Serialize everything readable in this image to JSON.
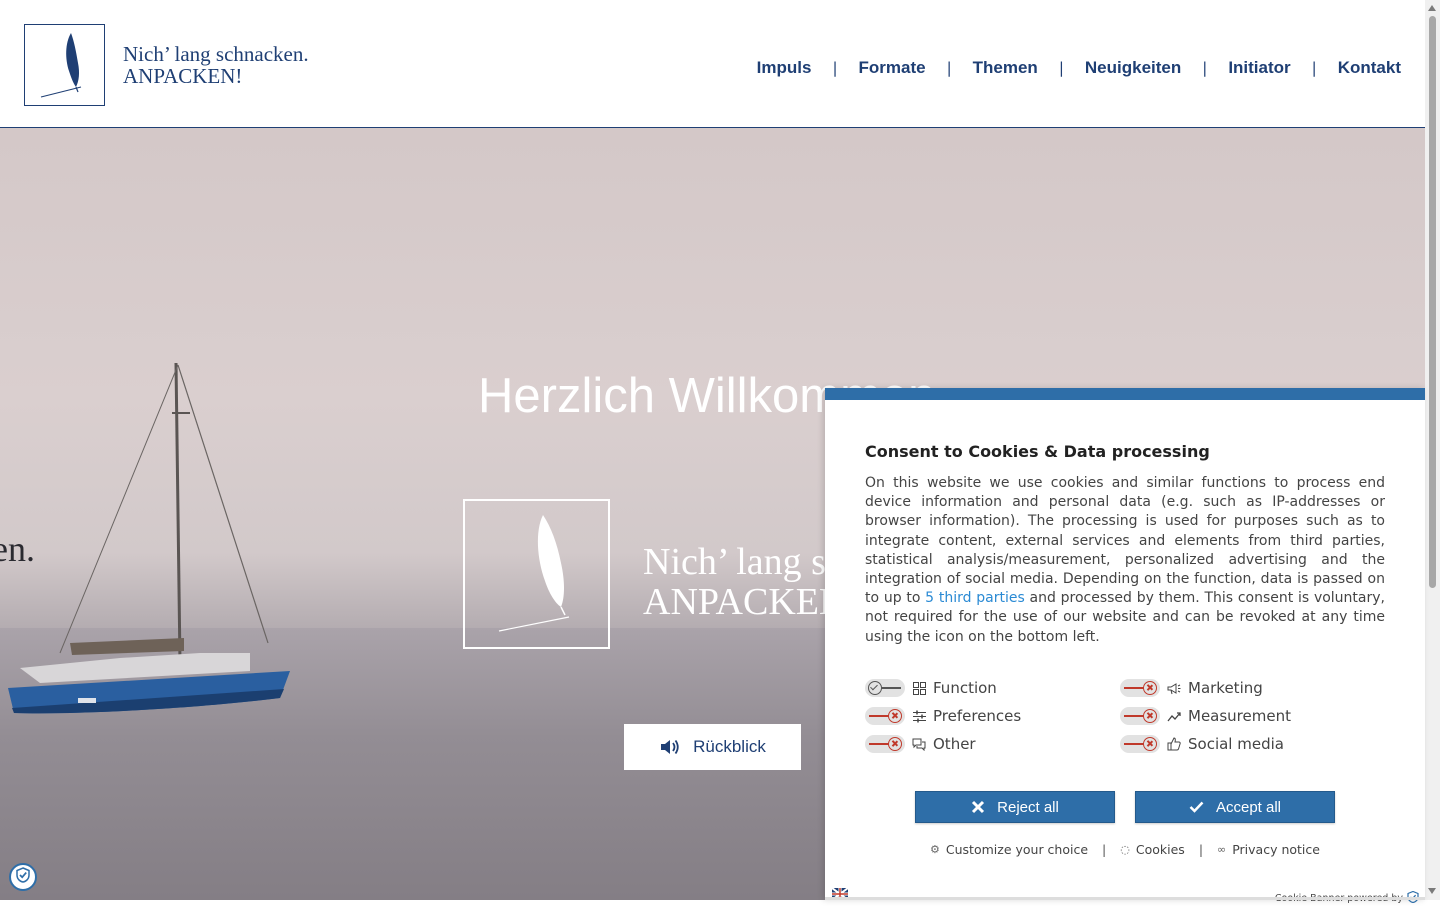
{
  "brand": {
    "line1": "Nich’ lang schnacken.",
    "line2": "ANPACKEN!"
  },
  "nav": [
    {
      "label": "Impuls"
    },
    {
      "label": "Formate"
    },
    {
      "label": "Themen"
    },
    {
      "label": "Neuigkeiten"
    },
    {
      "label": "Initiator"
    },
    {
      "label": "Kontakt"
    }
  ],
  "nav_separator": "|",
  "hero": {
    "title": "Herzlich Willkommen",
    "side_text": "en.",
    "logo_line1": "Nich’ lang schnacken.",
    "logo_line2": "ANPACKEN!",
    "button_label": "Rückblick"
  },
  "cookie": {
    "title": "Consent to Cookies & Data processing",
    "desc_part1": "On this website we use cookies and similar functions to process end device information and personal data (e.g. such as IP-addresses or browser information). The processing is used for purposes such as to integrate content, external services and elements from third parties, statistical analysis/measurement, personalized advertising and the integration of social media. Depending on the function, data is passed on to up to ",
    "desc_link": "5 third parties",
    "desc_part2": " and processed by them. This consent is voluntary, not required for the use of our website and can be revoked at any time using the icon on the bottom left.",
    "categories": [
      {
        "label": "Function",
        "icon": "grid-icon",
        "enabled": true
      },
      {
        "label": "Marketing",
        "icon": "megaphone-icon",
        "enabled": false
      },
      {
        "label": "Preferences",
        "icon": "sliders-icon",
        "enabled": false
      },
      {
        "label": "Measurement",
        "icon": "chart-icon",
        "enabled": false
      },
      {
        "label": "Other",
        "icon": "chat-icon",
        "enabled": false
      },
      {
        "label": "Social media",
        "icon": "thumbs-up-icon",
        "enabled": false
      }
    ],
    "reject_label": "Reject all",
    "accept_label": "Accept all",
    "customize_label": "Customize your choice",
    "cookies_label": "Cookies",
    "privacy_label": "Privacy notice",
    "link_separator": "|",
    "powered_label": "Cookie Banner powered by"
  },
  "colors": {
    "brand_blue": "#1f3f74",
    "banner_blue": "#2e6ea8",
    "link_blue": "#2a8ad4",
    "reject_red": "#c0392b"
  }
}
